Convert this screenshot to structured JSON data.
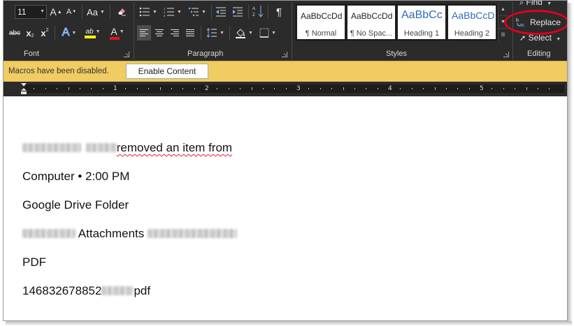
{
  "ribbon": {
    "font_size": "11",
    "groups": {
      "font": "Font",
      "paragraph": "Paragraph",
      "styles": "Styles",
      "editing": "Editing"
    },
    "font_buttons": {
      "grow": "A",
      "shrink": "A",
      "change_case": "Aa",
      "strikethrough": "abc",
      "subscript": "x",
      "superscript": "x",
      "text_effects": "A",
      "highlight": "ab",
      "font_color": "A"
    },
    "styles": [
      {
        "sample": "AaBbCcDd",
        "name": "¶ Normal"
      },
      {
        "sample": "AaBbCcDd",
        "name": "¶ No Spac..."
      },
      {
        "sample": "AaBbCc",
        "name": "Heading 1"
      },
      {
        "sample": "AaBbCcD",
        "name": "Heading 2"
      }
    ],
    "editing": {
      "find": "Find",
      "replace": "Replace",
      "select": "Select"
    }
  },
  "message_bar": {
    "text": "Macros have been disabled.",
    "button": "Enable Content"
  },
  "ruler": {
    "numbers": [
      "1",
      "2",
      "3",
      "4",
      "5"
    ]
  },
  "document": {
    "lines": {
      "line1_text": "removed an item from",
      "line2": "Computer • 2:00 PM",
      "line3": "Google Drive Folder",
      "line4_text": "Attachments",
      "line5": "PDF",
      "line6_prefix": "146832678852",
      "line6_suffix": "pdf"
    }
  },
  "colors": {
    "ribbon_bg": "#2b2b2b",
    "message_bar_bg": "#f0cc62",
    "highlight_ring": "#e1001a",
    "heading_blue": "#2f6eb5"
  }
}
